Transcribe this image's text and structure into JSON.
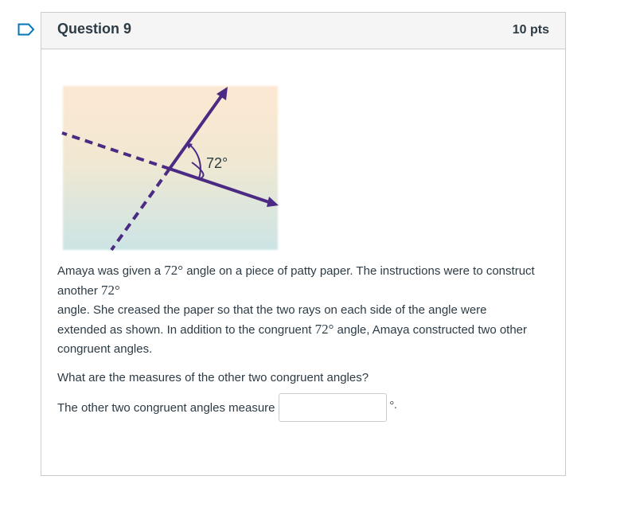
{
  "question": {
    "title": "Question 9",
    "points": "10 pts"
  },
  "figure": {
    "angle_label": "72°",
    "colors": {
      "ray": "#4b2a84",
      "gradient_top": "#fde8d2",
      "gradient_bottom": "#cce4e5"
    }
  },
  "body": {
    "p1_part1": "Amaya was given a ",
    "p1_math1": "72°",
    "p1_part2": " angle on a piece of patty paper. The instructions were to construct another ",
    "p1_math2": "72°",
    "p1_part3": "angle. She creased the paper so that the two rays on each side of the angle were extended as shown. In addition to the congruent ",
    "p1_math3": "72°",
    "p1_part4": " angle, Amaya constructed two other congruent angles.",
    "question_text": "What are the measures of the other two congruent angles?"
  },
  "answer": {
    "label": "The other two congruent angles measure",
    "value": "",
    "unit": "°."
  },
  "icons": {
    "flag": "bookmark-flag-icon"
  }
}
